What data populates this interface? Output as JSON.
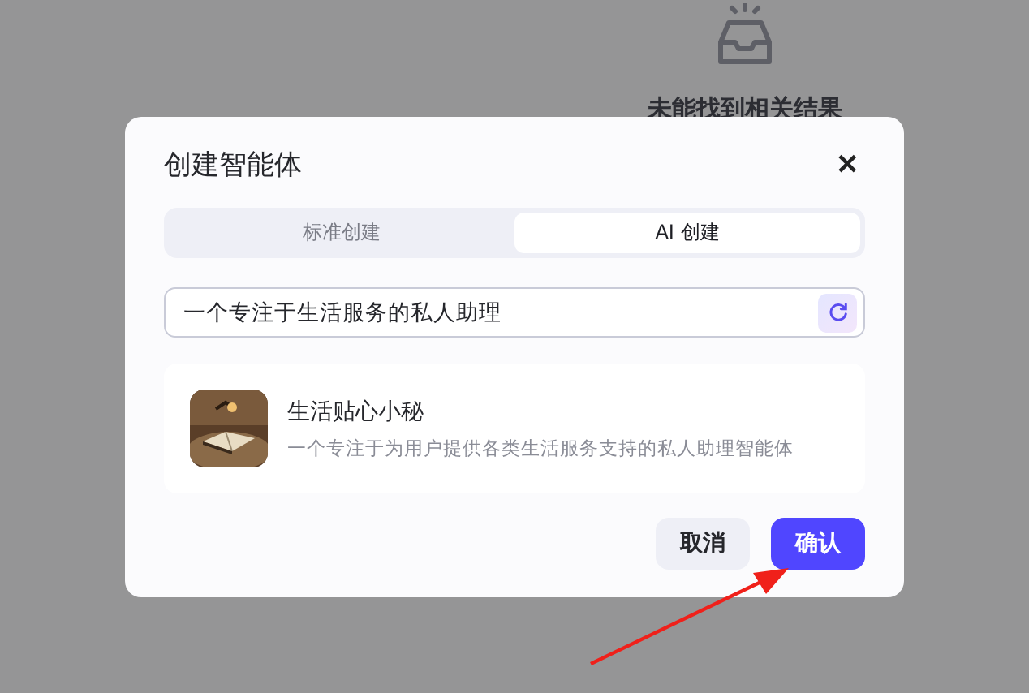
{
  "background": {
    "empty_message": "未能找到相关结果"
  },
  "dialog": {
    "title": "创建智能体",
    "close": "✕",
    "tabs": [
      {
        "label": "标准创建",
        "selected": false
      },
      {
        "label": "AI 创建",
        "selected": true
      }
    ],
    "prompt_field": {
      "value": "一个专注于生活服务的私人助理"
    },
    "result": {
      "name": "生活贴心小秘",
      "description": "一个专注于为用户提供各类生活服务支持的私人助理智能体"
    },
    "buttons": [
      {
        "label": "取消",
        "kind": "secondary"
      },
      {
        "label": "确认",
        "kind": "primary"
      }
    ]
  }
}
